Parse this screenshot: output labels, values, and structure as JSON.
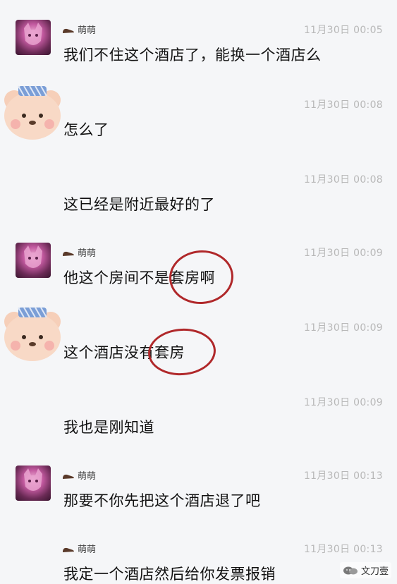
{
  "messages": [
    {
      "sender": "萌萌",
      "time": "11月30日 00:05",
      "text": "我们不住这个酒店了，能换一个酒店么"
    },
    {
      "sender": "",
      "time": "11月30日 00:08",
      "text": "怎么了"
    },
    {
      "sender": "",
      "time": "11月30日 00:08",
      "text": "这已经是附近最好的了"
    },
    {
      "sender": "萌萌",
      "time": "11月30日 00:09",
      "text": "他这个房间不是套房啊"
    },
    {
      "sender": "",
      "time": "11月30日 00:09",
      "text": "这个酒店没有套房"
    },
    {
      "sender": "",
      "time": "11月30日 00:09",
      "text": "我也是刚知道"
    },
    {
      "sender": "萌萌",
      "time": "11月30日 00:13",
      "text": "那要不你先把这个酒店退了吧"
    },
    {
      "sender": "萌萌",
      "time": "11月30日 00:13",
      "text": "我定一个酒店然后给你发票报销"
    }
  ],
  "watermark": "文刀壹",
  "colors": {
    "circle": "#b0282a",
    "time": "#b8b8b8",
    "background": "#f5f6f8"
  }
}
